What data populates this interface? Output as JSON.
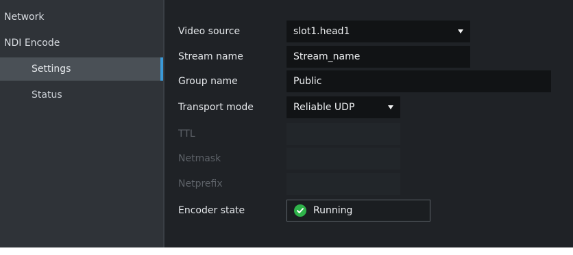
{
  "sidebar": {
    "items": [
      {
        "label": "Network"
      },
      {
        "label": "NDI Encode"
      },
      {
        "label": "Settings"
      },
      {
        "label": "Status"
      }
    ]
  },
  "form": {
    "video_source": {
      "label": "Video source",
      "value": "slot1.head1"
    },
    "stream_name": {
      "label": "Stream name",
      "value": "Stream_name"
    },
    "group_name": {
      "label": "Group name",
      "value": "Public"
    },
    "transport_mode": {
      "label": "Transport mode",
      "value": "Reliable UDP"
    },
    "ttl": {
      "label": "TTL",
      "value": ""
    },
    "netmask": {
      "label": "Netmask",
      "value": ""
    },
    "netprefix": {
      "label": "Netprefix",
      "value": ""
    },
    "encoder_state": {
      "label": "Encoder state",
      "value": "Running"
    }
  },
  "icons": {
    "dropdown": "chevron-down-icon",
    "status_ok": "check-circle-icon"
  },
  "colors": {
    "accent": "#3a9ad9",
    "status_ok": "#2fb34a"
  }
}
